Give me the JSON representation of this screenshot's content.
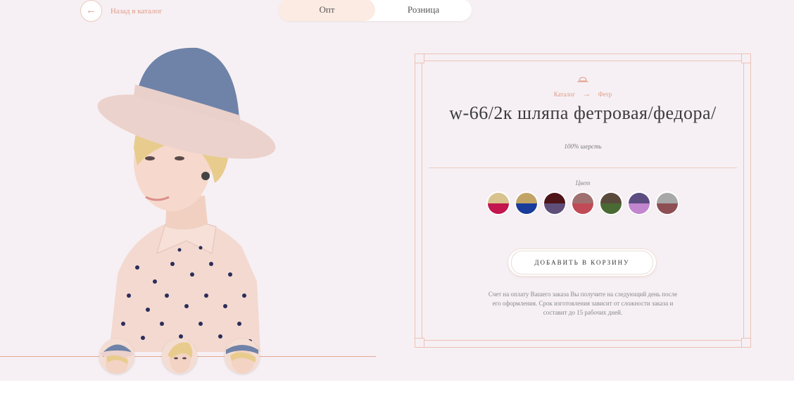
{
  "nav": {
    "back_label": "Назад в каталог",
    "toggle": [
      {
        "label": "Опт",
        "active": true
      },
      {
        "label": "Розница",
        "active": false
      }
    ]
  },
  "product": {
    "breadcrumb": {
      "catalog": "Каталог",
      "category": "Фетр"
    },
    "title": "w-66/2к шляпа фетровая/федора/",
    "material": "100% шерсть",
    "color_label": "Цвет",
    "colors": [
      {
        "top": "#d8c28e",
        "bottom": "#c3154e"
      },
      {
        "top": "#c2a366",
        "bottom": "#193b9a"
      },
      {
        "top": "#4f1418",
        "bottom": "#5e4e78"
      },
      {
        "top": "#a07070",
        "bottom": "#c04a55"
      },
      {
        "top": "#5a4a3c",
        "bottom": "#4a6a33"
      },
      {
        "top": "#5d4c80",
        "bottom": "#c286cf"
      },
      {
        "top": "#a8a8a8",
        "bottom": "#8e4f54"
      }
    ],
    "add_to_cart": "ДОБАВИТЬ В КОРЗИНУ",
    "note": "Счет на оплату Вашего заказа Вы получите на следующий день после его оформления. Срок изготовления зависит от сложности заказа и составит до 15 рабочих дней."
  },
  "gallery": {
    "thumbnails": [
      "thumb-front",
      "thumb-side",
      "thumb-back"
    ]
  },
  "colors": {
    "accent": "#e09a85",
    "background": "#f6f0f4"
  }
}
